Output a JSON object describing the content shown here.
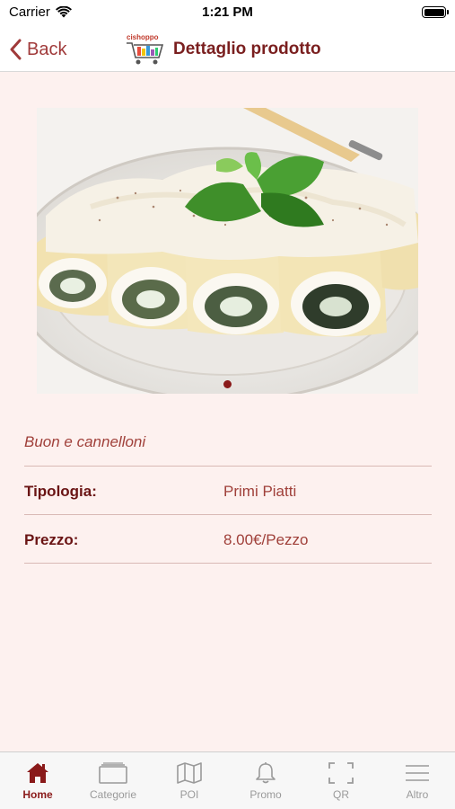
{
  "status_bar": {
    "carrier": "Carrier",
    "time": "1:21 PM"
  },
  "nav": {
    "back_label": "Back",
    "title": "Dettaglio prodotto",
    "logo_text": "cishoppo"
  },
  "product": {
    "image_alt": "Cannelloni",
    "description": "Buon e cannelloni",
    "carousel_page_count": 1,
    "carousel_current_page": 1,
    "details": [
      {
        "label": "Tipologia:",
        "value": "Primi Piatti"
      },
      {
        "label": "Prezzo:",
        "value": "8.00€/Pezzo"
      }
    ]
  },
  "tab_bar": {
    "items": [
      {
        "label": "Home",
        "icon": "home-icon",
        "active": true
      },
      {
        "label": "Categorie",
        "icon": "categories-icon",
        "active": false
      },
      {
        "label": "POI",
        "icon": "map-icon",
        "active": false
      },
      {
        "label": "Promo",
        "icon": "bell-icon",
        "active": false
      },
      {
        "label": "QR",
        "icon": "qr-scan-icon",
        "active": false
      },
      {
        "label": "Altro",
        "icon": "menu-icon",
        "active": false
      }
    ]
  },
  "colors": {
    "accent": "#8a1a1a",
    "accent_light": "#a0403a",
    "background": "#fdf1ef"
  }
}
